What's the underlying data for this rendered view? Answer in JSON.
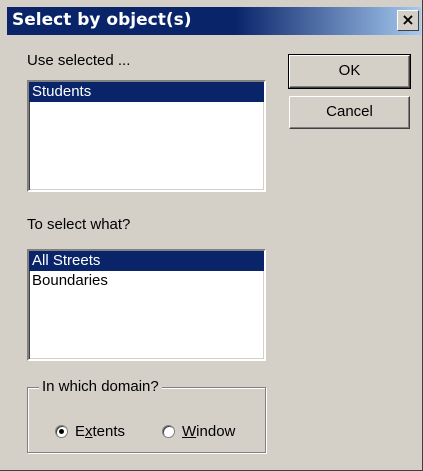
{
  "dialog": {
    "title": "Select by object(s)",
    "close_glyph": "✕"
  },
  "source": {
    "label": "Use selected ...",
    "items": [
      "Students"
    ],
    "selected_index": 0
  },
  "target": {
    "label": "To select what?",
    "items": [
      "All Streets",
      "Boundaries"
    ],
    "selected_index": 0
  },
  "buttons": {
    "ok_label": "OK",
    "cancel_label": "Cancel"
  },
  "domain": {
    "label": "In which domain?",
    "options": [
      {
        "label": "Extents",
        "mnemonic_index": 1,
        "checked": true
      },
      {
        "label": "Window",
        "mnemonic_index": 0,
        "checked": false
      }
    ]
  },
  "colors": {
    "title_bar": "#0a246a",
    "selection": "#0a246a",
    "face": "#d4d0c8"
  },
  "icons": {
    "close": "close-icon",
    "radio": "radio-button-icon"
  }
}
